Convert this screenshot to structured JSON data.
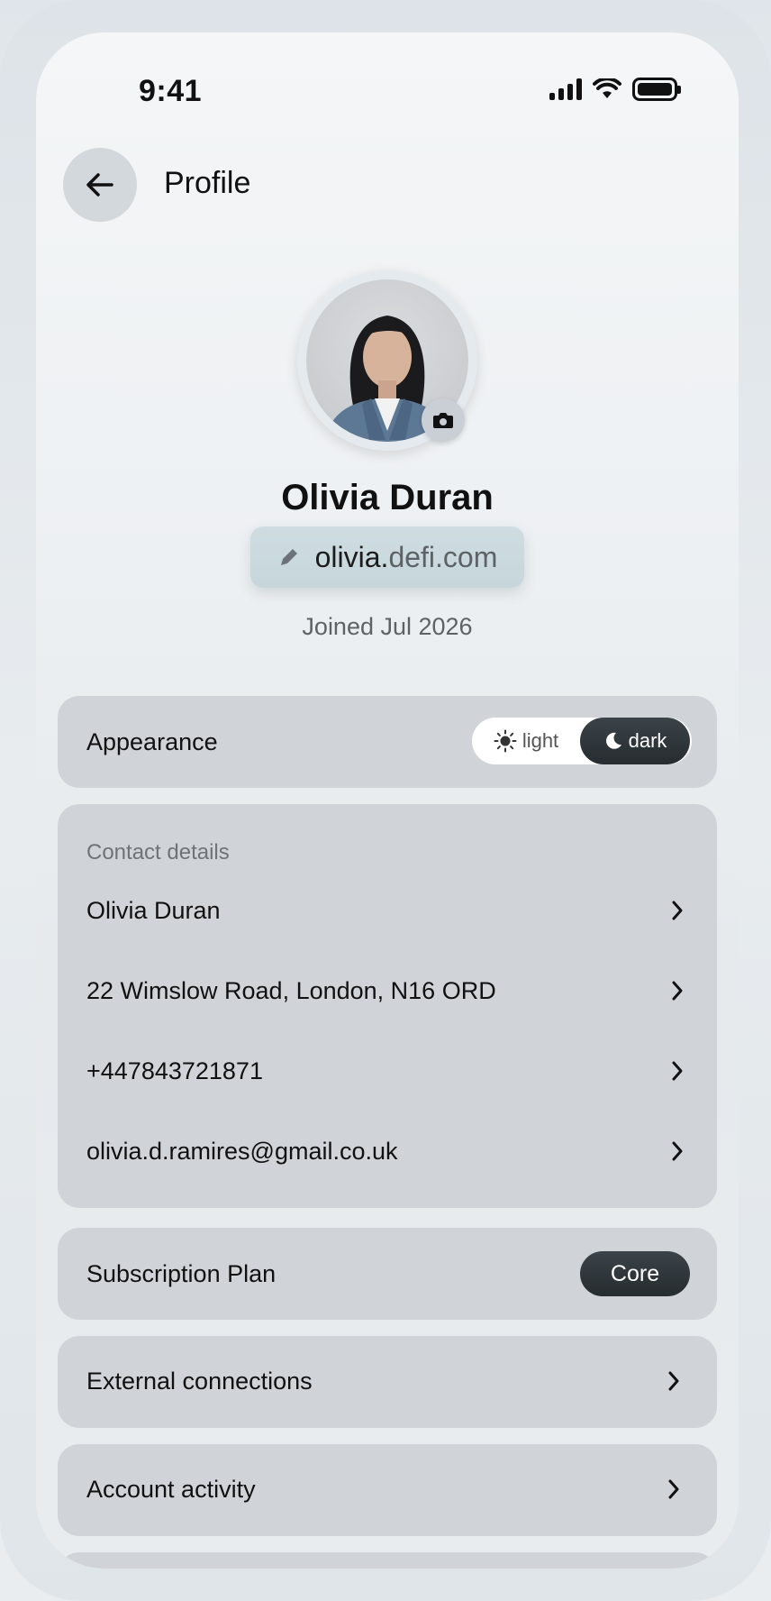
{
  "status_bar": {
    "time": "9:41"
  },
  "header": {
    "title": "Profile"
  },
  "profile": {
    "name": "Olivia Duran",
    "domain_prefix": "olivia.",
    "domain_suffix": "defi.com",
    "joined": "Joined Jul 2026"
  },
  "appearance": {
    "label": "Appearance",
    "light_label": "light",
    "dark_label": "dark",
    "selected": "dark"
  },
  "contact": {
    "section_label": "Contact details",
    "rows": [
      {
        "value": "Olivia Duran"
      },
      {
        "value": "22 Wimslow Road, London, N16 ORD"
      },
      {
        "value": "+447843721871"
      },
      {
        "value": "olivia.d.ramires@gmail.co.uk"
      }
    ]
  },
  "subscription": {
    "label": "Subscription Plan",
    "plan": "Core"
  },
  "external": {
    "label": "External connections"
  },
  "activity": {
    "label": "Account activity"
  },
  "colors": {
    "card_bg": "#d0d4d9",
    "dark_pill": "#2b3135",
    "domain_pill": "#c9d9dd"
  }
}
